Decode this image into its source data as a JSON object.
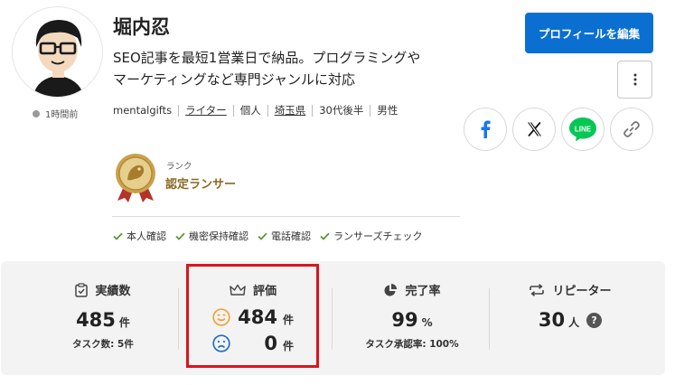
{
  "profile": {
    "name": "堀内忍",
    "catch_line1": "SEO記事を最短1営業日で納品。プログラミングや",
    "catch_line2": "マーケティングなど専門ジャンルに対応",
    "last_login": "1時間前",
    "meta": {
      "username": "mentalgifts",
      "role": "ライター",
      "type": "個人",
      "prefecture": "埼玉県",
      "age": "30代後半",
      "gender": "男性"
    },
    "rank": {
      "label": "ランク",
      "name": "認定ランサー"
    },
    "verifications": [
      "本人確認",
      "機密保持確認",
      "電話確認",
      "ランサーズチェック"
    ]
  },
  "actions": {
    "edit_label": "プロフィールを編集",
    "share": [
      "facebook-share",
      "x-share",
      "line-share",
      "copy-link"
    ],
    "line_text": "LINE"
  },
  "stats": {
    "achievements": {
      "title": "実績数",
      "value": "485",
      "unit": "件",
      "sub": "タスク数: 5件"
    },
    "rating": {
      "title": "評価",
      "good": "484",
      "bad": "0",
      "unit": "件"
    },
    "completion": {
      "title": "完了率",
      "value": "99",
      "unit": "%",
      "sub": "タスク承認率: 100%"
    },
    "repeater": {
      "title": "リピーター",
      "value": "30",
      "unit": "人",
      "help": "?"
    }
  },
  "colors": {
    "primary": "#0b6fd1",
    "highlight": "#d9141e",
    "check": "#5a9a2e",
    "good": "#f2a33a",
    "bad": "#1f6fc4",
    "line": "#06c755",
    "facebook": "#1877f2"
  }
}
